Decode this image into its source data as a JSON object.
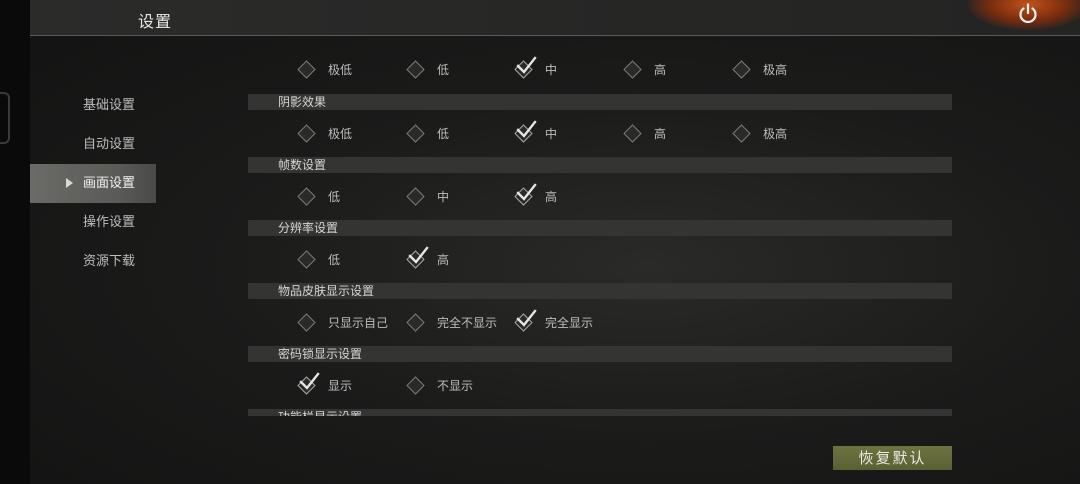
{
  "header": {
    "title": "设置",
    "power_icon": "power-icon"
  },
  "sidebar": {
    "items": [
      {
        "label": "基础设置",
        "active": false
      },
      {
        "label": "自动设置",
        "active": false
      },
      {
        "label": "画面设置",
        "active": true
      },
      {
        "label": "操作设置",
        "active": false
      },
      {
        "label": "资源下载",
        "active": false
      }
    ]
  },
  "settings": {
    "top_row": {
      "options": [
        "极低",
        "低",
        "中",
        "高",
        "极高"
      ],
      "selected": 2
    },
    "sections": [
      {
        "title": "阴影效果",
        "options": [
          "极低",
          "低",
          "中",
          "高",
          "极高"
        ],
        "selected": 2
      },
      {
        "title": "帧数设置",
        "options": [
          "低",
          "中",
          "高"
        ],
        "selected": 2
      },
      {
        "title": "分辨率设置",
        "options": [
          "低",
          "高"
        ],
        "selected": 1
      },
      {
        "title": "物品皮肤显示设置",
        "options": [
          "只显示自己",
          "完全不显示",
          "完全显示"
        ],
        "selected": 2
      },
      {
        "title": "密码锁显示设置",
        "options": [
          "显示",
          "不显示"
        ],
        "selected": 0
      },
      {
        "title": "功能栏显示设置",
        "options": [],
        "selected": -1
      }
    ]
  },
  "footer": {
    "restore_label": "恢复默认"
  },
  "colors": {
    "accent_button": "#5b6034",
    "active_nav": "#5a5a57",
    "section_bar": "#343433"
  }
}
